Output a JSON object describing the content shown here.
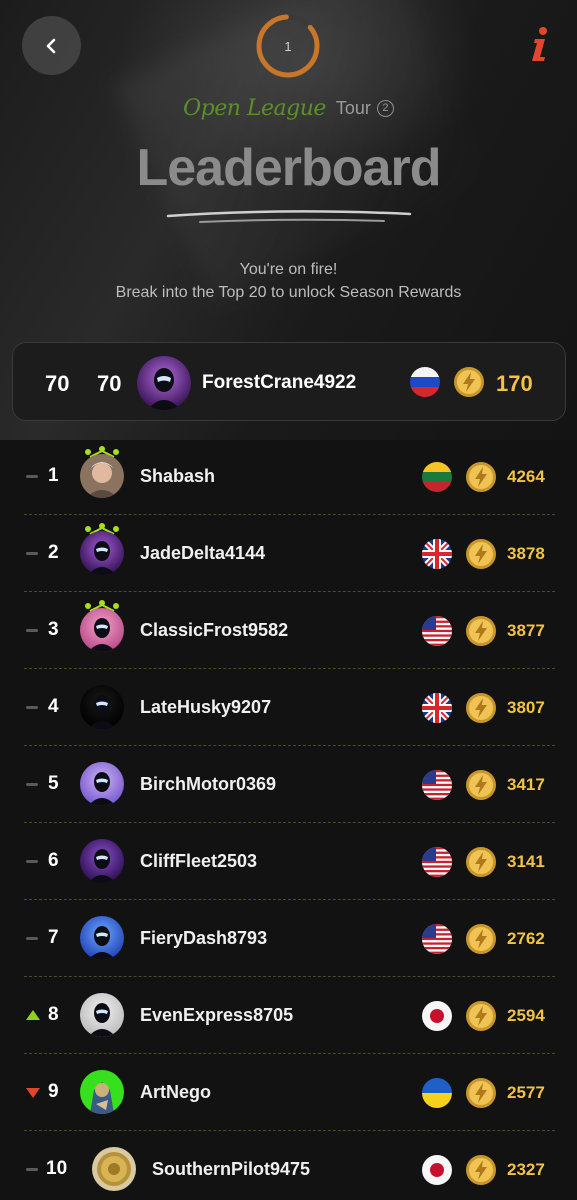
{
  "header": {
    "tour_number": "1",
    "league_name": "Open League",
    "tour_label": "Tour",
    "tour_badge": "2",
    "title": "Leaderboard"
  },
  "message": {
    "line1": "You're on fire!",
    "line2": "Break into the Top 20 to unlock Season Rewards"
  },
  "me": {
    "rank_a": "70",
    "rank_b": "70",
    "name": "ForestCrane4922",
    "flag": "russia",
    "score": "170"
  },
  "colors": {
    "accent_gold": "#f2c243",
    "league_green": "#5c8f2a",
    "ring_orange": "#c8762a",
    "info_red": "#e3452f",
    "trend_up": "#8bd11e",
    "trend_down": "#e0452e"
  },
  "leaderboard": [
    {
      "trend": "same",
      "rank": "1",
      "name": "Shabash",
      "flag": "lithuania",
      "score": "4264",
      "avatar": "photo-man",
      "crown": true
    },
    {
      "trend": "same",
      "rank": "2",
      "name": "JadeDelta4144",
      "flag": "uk",
      "score": "3878",
      "avatar": "purple",
      "crown": true
    },
    {
      "trend": "same",
      "rank": "3",
      "name": "ClassicFrost9582",
      "flag": "usa",
      "score": "3877",
      "avatar": "pink",
      "crown": true
    },
    {
      "trend": "same",
      "rank": "4",
      "name": "LateHusky9207",
      "flag": "uk",
      "score": "3807",
      "avatar": "black",
      "crown": false
    },
    {
      "trend": "same",
      "rank": "5",
      "name": "BirchMotor0369",
      "flag": "usa",
      "score": "3417",
      "avatar": "lavender",
      "crown": false
    },
    {
      "trend": "same",
      "rank": "6",
      "name": "CliffFleet2503",
      "flag": "usa",
      "score": "3141",
      "avatar": "violet",
      "crown": false
    },
    {
      "trend": "same",
      "rank": "7",
      "name": "FieryDash8793",
      "flag": "usa",
      "score": "2762",
      "avatar": "blue",
      "crown": false
    },
    {
      "trend": "up",
      "rank": "8",
      "name": "EvenExpress8705",
      "flag": "japan",
      "score": "2594",
      "avatar": "white",
      "crown": false
    },
    {
      "trend": "down",
      "rank": "9",
      "name": "ArtNego",
      "flag": "ukraine",
      "score": "2577",
      "avatar": "green-art",
      "crown": false
    },
    {
      "trend": "same",
      "rank": "10",
      "name": "SouthernPilot9475",
      "flag": "japan",
      "score": "2327",
      "avatar": "gold-coin",
      "crown": false
    }
  ]
}
